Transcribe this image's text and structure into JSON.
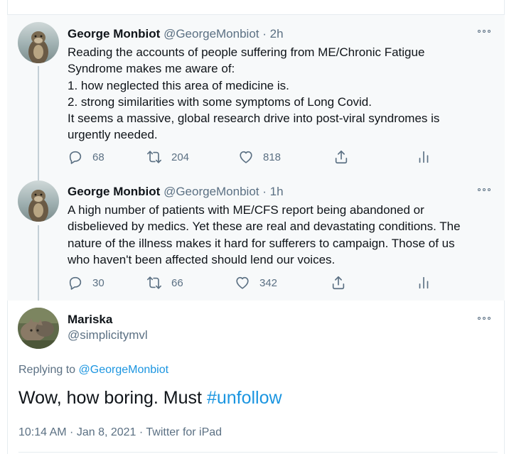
{
  "thread": [
    {
      "author_name": "George Monbiot",
      "handle": "@GeorgeMonbiot",
      "time": "· 2h",
      "lines": [
        "Reading the accounts of people suffering from ME/Chronic Fatigue",
        "Syndrome makes me aware of:",
        "1. how neglected this area of medicine is.",
        "2. strong similarities with some symptoms of Long Covid.",
        "It seems a massive, global research drive into post-viral syndromes is",
        "urgently needed."
      ],
      "replies": "68",
      "retweets": "204",
      "likes": "818"
    },
    {
      "author_name": "George Monbiot",
      "handle": "@GeorgeMonbiot",
      "time": "· 1h",
      "lines": [
        "A high number of patients with ME/CFS report being abandoned or",
        "disbelieved by medics. Yet these are real and devastating conditions. The",
        "nature of the illness makes it hard for sufferers to campaign. Those of us",
        "who haven't been affected should lend our voices."
      ],
      "replies": "30",
      "retweets": "66",
      "likes": "342"
    }
  ],
  "reply": {
    "author_name": "Mariska",
    "handle": "@simplicitymvl",
    "replying_prefix": "Replying to",
    "replying_to": "@GeorgeMonbiot",
    "text": "Wow, how boring. Must",
    "hashtag": "#unfollow",
    "meta": "10:14 AM · Jan 8, 2021 · Twitter for iPad"
  },
  "icons": {
    "reply": "reply-icon",
    "retweet": "retweet-icon",
    "like": "heart-icon",
    "share": "share-icon",
    "analytics": "analytics-icon",
    "more": "more-icon"
  },
  "colors": {
    "link": "#1b95e0",
    "muted": "#5b7083",
    "text": "#0f1419",
    "thread_bg": "#f7f9fa"
  }
}
